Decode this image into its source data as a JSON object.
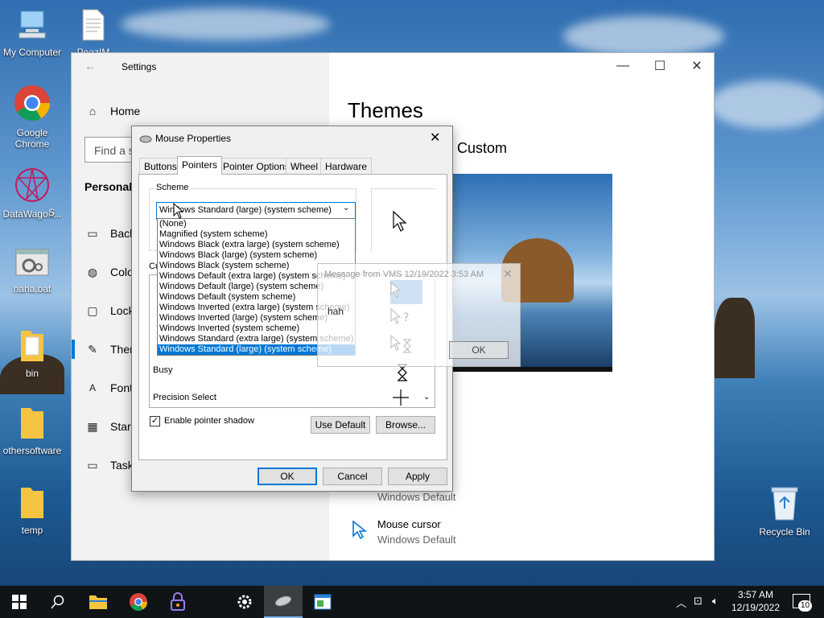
{
  "desktop": {
    "icons": [
      {
        "label": "My Computer"
      },
      {
        "label": "PeazIM"
      },
      {
        "label": "Google Chrome"
      },
      {
        "label": "DataWagon..."
      },
      {
        "label": "S"
      },
      {
        "label": "haha.bat"
      },
      {
        "label": "bin"
      },
      {
        "label": "othersoftware"
      },
      {
        "label": "temp"
      },
      {
        "label": "Recycle Bin"
      }
    ]
  },
  "settings": {
    "title": "Settings",
    "home_label": "Home",
    "search_placeholder": "Find a s",
    "section_title": "Personaliz",
    "nav": [
      {
        "label": "Back",
        "icon": "image-icon"
      },
      {
        "label": "Colo",
        "icon": "palette-icon"
      },
      {
        "label": "Lock",
        "icon": "lock-screen-icon"
      },
      {
        "label": "Ther",
        "icon": "brush-icon"
      },
      {
        "label": "Fonts",
        "icon": "fonts-icon"
      },
      {
        "label": "Start",
        "icon": "start-icon"
      },
      {
        "label": "Taskb",
        "icon": "taskbar-icon"
      }
    ],
    "page_title": "Themes",
    "current_theme": "Custom",
    "items": [
      {
        "title": "",
        "value": "Windows Default"
      },
      {
        "title": "Mouse cursor",
        "value": "Windows Default"
      }
    ]
  },
  "mouse": {
    "title": "Mouse Properties",
    "tabs": [
      "Buttons",
      "Pointers",
      "Pointer Options",
      "Wheel",
      "Hardware"
    ],
    "scheme_label": "Scheme",
    "scheme_selected": "Windows Standard (large) (system scheme)",
    "scheme_options": [
      "(None)",
      "Magnified (system scheme)",
      "Windows Black (extra large) (system scheme)",
      "Windows Black (large) (system scheme)",
      "Windows Black (system scheme)",
      "Windows Default (extra large) (system scheme)",
      "Windows Default (large) (system scheme)",
      "Windows Default (system scheme)",
      "Windows Inverted (extra large) (system scheme)",
      "Windows Inverted (large) (system scheme)",
      "Windows Inverted (system scheme)",
      "Windows Standard (extra large) (system scheme)",
      "Windows Standard (large) (system scheme)"
    ],
    "customize_label": "Cu",
    "list_rows": [
      "Busy",
      "Precision Select"
    ],
    "shadow_label": "Enable pointer shadow",
    "use_default": "Use Default",
    "browse": "Browse...",
    "ok": "OK",
    "cancel": "Cancel",
    "apply": "Apply"
  },
  "msgbox": {
    "title": "Message from VMS 12/19/2022 3:53 AM",
    "text": "hah",
    "ok": "OK"
  },
  "taskbar": {
    "time": "3:57 AM",
    "date": "12/19/2022",
    "notifications": "10"
  },
  "colors": {
    "accent": "#0078d7",
    "taskbar": "#101417"
  }
}
